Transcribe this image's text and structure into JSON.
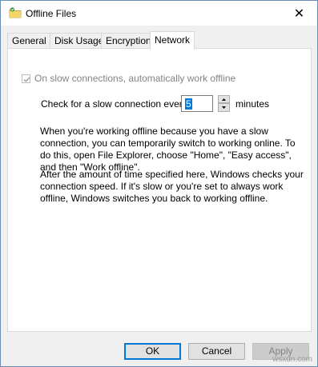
{
  "window": {
    "title": "Offline Files",
    "icon": "offline-files-folder-icon",
    "close_glyph": "✕"
  },
  "tabs": [
    {
      "label": "General",
      "active": false
    },
    {
      "label": "Disk Usage",
      "active": false
    },
    {
      "label": "Encryption",
      "active": false
    },
    {
      "label": "Network",
      "active": true
    }
  ],
  "network": {
    "auto_offline_label": "On slow connections, automatically work offline",
    "auto_offline_checked": true,
    "auto_offline_enabled": false,
    "check_label": "Check for a slow connection every",
    "interval_value": "5",
    "interval_unit": "minutes",
    "paragraph1": "When you're working offline because you have a slow connection, you can temporarily switch to working online. To do this, open File Explorer, choose \"Home\", \"Easy access\", and then \"Work offline\".",
    "paragraph2": "After the amount of time specified here, Windows checks your connection speed. If it's slow or you're set to always work offline, Windows switches you back to working offline."
  },
  "buttons": {
    "ok": "OK",
    "cancel": "Cancel",
    "apply": "Apply"
  },
  "watermark": "wsxdn.com",
  "colors": {
    "accent": "#0078d7",
    "disabled_text": "#838383"
  }
}
